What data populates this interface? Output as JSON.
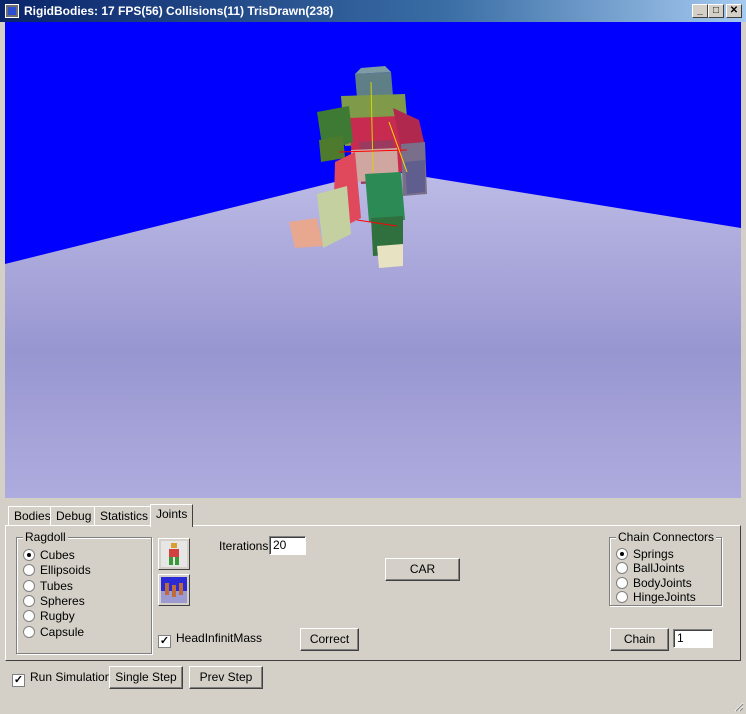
{
  "window": {
    "title": "RigidBodies: 17 FPS(56) Collisions(11) TrisDrawn(238)",
    "minimize_glyph": "_",
    "maximize_glyph": "□",
    "close_glyph": "✕"
  },
  "scene": {
    "sky_color": "#0000ff",
    "floor_color": "#a9a6d9"
  },
  "tabs": [
    {
      "label": "Bodies",
      "active": false
    },
    {
      "label": "Debug",
      "active": false
    },
    {
      "label": "Statistics",
      "active": false
    },
    {
      "label": "Joints",
      "active": true
    }
  ],
  "ragdoll": {
    "title": "Ragdoll",
    "options": [
      {
        "label": "Cubes",
        "checked": true
      },
      {
        "label": "Ellipsoids",
        "checked": false
      },
      {
        "label": "Tubes",
        "checked": false
      },
      {
        "label": "Spheres",
        "checked": false
      },
      {
        "label": "Rugby",
        "checked": false
      },
      {
        "label": "Capsule",
        "checked": false
      }
    ]
  },
  "iterations": {
    "label": "Iterations",
    "value": "20"
  },
  "car_button": "CAR",
  "head_infinite_mass": {
    "label": "HeadInfinitMass",
    "checked": true
  },
  "correct_button": "Correct",
  "chain_connectors": {
    "title": "Chain Connectors",
    "options": [
      {
        "label": "Springs",
        "checked": true
      },
      {
        "label": "BallJoints",
        "checked": false
      },
      {
        "label": "BodyJoints",
        "checked": false
      },
      {
        "label": "HingeJoints",
        "checked": false
      }
    ]
  },
  "chain_button": "Chain",
  "chain_count": "1",
  "bottom_bar": {
    "run_simulation": {
      "label": "Run Simulation",
      "checked": true
    },
    "single_step": "Single Step",
    "prev_step": "Prev Step"
  }
}
